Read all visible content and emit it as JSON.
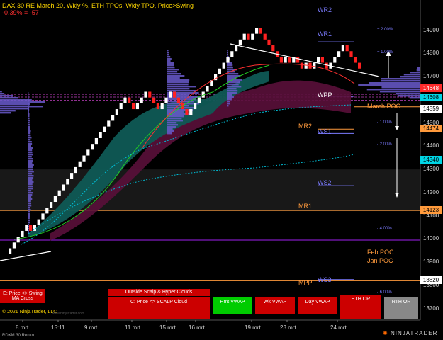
{
  "header": {
    "title": "DAX 30 RE March 20, Wkly %, ETH TPOs, Wkly TPO, Price>Swing",
    "change": "-0.39% = -57"
  },
  "chart_data": {
    "type": "renko",
    "instrument": "DAX 30 RE March 20",
    "bar_type": "RDXM 30 Renko",
    "ylim": [
      13650,
      15000
    ],
    "y_ticks": [
      14900,
      14800,
      14700,
      14600,
      14500,
      14400,
      14300,
      14200,
      14100,
      14000,
      13900,
      13800,
      13700
    ],
    "x_labels": [
      "8 mrt",
      "15:11",
      "9 mrt",
      "11 mrt",
      "15 mrt",
      "16 mrt",
      "19 mrt",
      "23 mrt",
      "24 mrt"
    ],
    "price_tags": [
      {
        "value": "14648",
        "bg": "#ff2b2b",
        "fg": "#ffffff"
      },
      {
        "value": "14608",
        "bg": "#00d5e5",
        "fg": "#000000"
      },
      {
        "value": "14559",
        "bg": "#ffffff",
        "fg": "#000000"
      },
      {
        "value": "14474",
        "bg": "#ff9a3c",
        "fg": "#000000"
      },
      {
        "value": "14340",
        "bg": "#00d5e5",
        "fg": "#000000"
      },
      {
        "value": "14123",
        "bg": "#ff9a3c",
        "fg": "#000000"
      },
      {
        "value": "13820",
        "bg": "#ffffff",
        "fg": "#000000"
      }
    ],
    "levels": [
      {
        "label": "WR2",
        "color": "#7b7bff"
      },
      {
        "label": "WR1",
        "color": "#7b7bff"
      },
      {
        "label": "WPP",
        "color": "#ffffff"
      },
      {
        "label": "March POC",
        "color": "#ff9a3c"
      },
      {
        "label": "MR2",
        "color": "#ff9a3c"
      },
      {
        "label": "WS1",
        "color": "#7b7bff"
      },
      {
        "label": "WS2",
        "color": "#7b7bff"
      },
      {
        "label": "MR1",
        "color": "#ff9a3c"
      },
      {
        "label": "Feb POC",
        "color": "#ff9a3c"
      },
      {
        "label": "Jan POC",
        "color": "#ff9a3c"
      },
      {
        "label": "MPP",
        "color": "#ff9a3c"
      },
      {
        "label": "WS3",
        "color": "#7b7bff"
      }
    ],
    "pct_labels": [
      "+ 2.00%",
      "+ 1.00%",
      "- 1.00%",
      "- 2.00%",
      "- 4.00%",
      "- 6.00%"
    ]
  },
  "panel": {
    "buttons": [
      {
        "label": "E: Price <> Swing\nMA Cross",
        "bg": "#cc0000"
      },
      {
        "label": "Outside Scalp & Hyper Clouds",
        "bg": "#cc0000"
      },
      {
        "label": "C: Price <> SCALP Cloud",
        "bg": "#cc0000"
      },
      {
        "label": "Hmt VWAP",
        "bg": "#00cc00"
      },
      {
        "label": "Wk VWAP",
        "bg": "#cc0000"
      },
      {
        "label": "Day VWAP",
        "bg": "#cc0000"
      },
      {
        "label": "ETH OR",
        "bg": "#cc0000"
      },
      {
        "label": "RTH OR",
        "bg": "#888888"
      }
    ]
  },
  "footer": {
    "copyright": "© 2021 NinjaTrader, LLC",
    "watermark": "www.ninjatrader.com",
    "instrument": "RDXM 30 Renko",
    "logo": "NINJATRADER"
  },
  "colors": {
    "up": "#ffffff",
    "down": "#ff2020",
    "accent": "#7b7bff",
    "cloud_green": "#0f5a55",
    "cloud_red": "#5a0f3a"
  }
}
